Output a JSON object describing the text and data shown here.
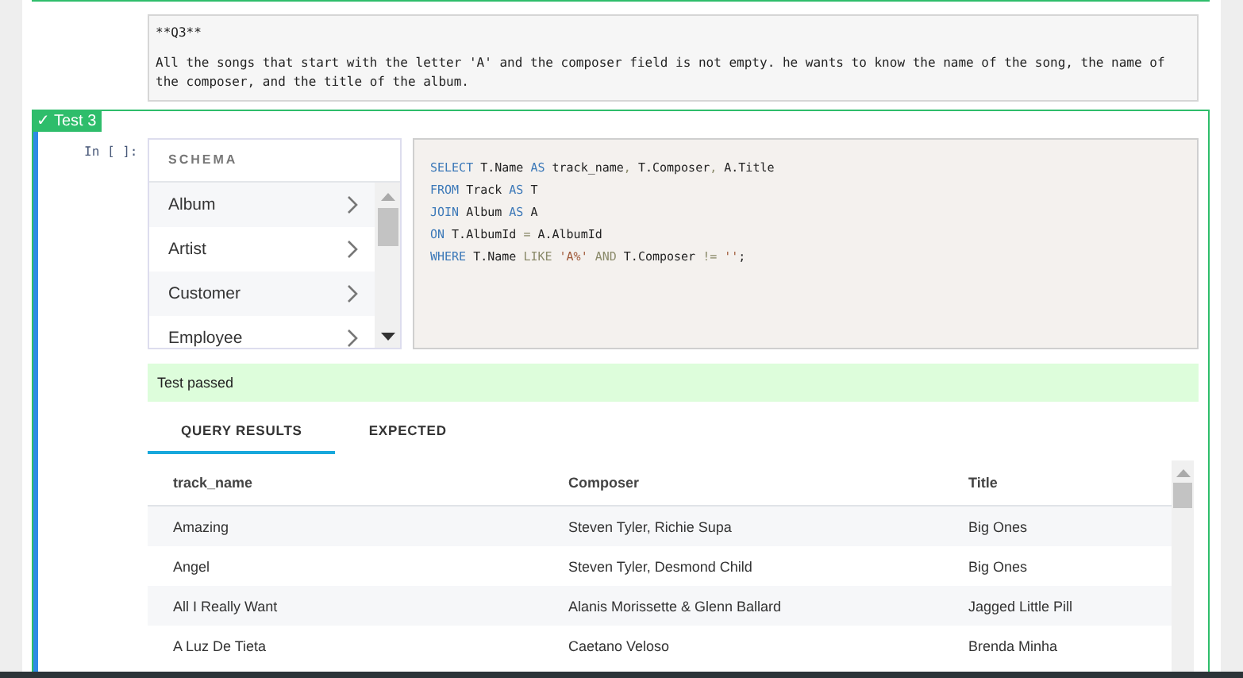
{
  "markdown_cell": {
    "heading": "**Q3**",
    "body": "All the songs that start with the letter 'A' and the composer field is not empty. he wants to know the name of the song, the name of the composer, and the title of the album."
  },
  "test_cell": {
    "badge_mark": "✓",
    "badge": "Test 3",
    "prompt": "In [ ]:",
    "schema": {
      "title": "SCHEMA",
      "items": [
        {
          "label": "Album"
        },
        {
          "label": "Artist"
        },
        {
          "label": "Customer"
        },
        {
          "label": "Employee"
        }
      ]
    },
    "code": [
      [
        {
          "kind": "kw",
          "text": "SELECT"
        },
        {
          "kind": "id",
          "text": " T.Name "
        },
        {
          "kind": "kw",
          "text": "AS"
        },
        {
          "kind": "id",
          "text": " track_name"
        },
        {
          "kind": "op",
          "text": ","
        },
        {
          "kind": "id",
          "text": " T.Composer"
        },
        {
          "kind": "op",
          "text": ","
        },
        {
          "kind": "id",
          "text": " A.Title"
        }
      ],
      [
        {
          "kind": "kw",
          "text": "FROM"
        },
        {
          "kind": "id",
          "text": " Track "
        },
        {
          "kind": "kw",
          "text": "AS"
        },
        {
          "kind": "id",
          "text": " T"
        }
      ],
      [
        {
          "kind": "kw",
          "text": "JOIN"
        },
        {
          "kind": "id",
          "text": " Album "
        },
        {
          "kind": "kw",
          "text": "AS"
        },
        {
          "kind": "id",
          "text": " A"
        }
      ],
      [
        {
          "kind": "kw",
          "text": "ON"
        },
        {
          "kind": "id",
          "text": " T.AlbumId "
        },
        {
          "kind": "op",
          "text": "="
        },
        {
          "kind": "id",
          "text": " A.AlbumId"
        }
      ],
      [
        {
          "kind": "kw",
          "text": "WHERE"
        },
        {
          "kind": "id",
          "text": " T.Name "
        },
        {
          "kind": "op",
          "text": "LIKE"
        },
        {
          "kind": "str",
          "text": " 'A%' "
        },
        {
          "kind": "op",
          "text": "AND"
        },
        {
          "kind": "id",
          "text": " T.Composer "
        },
        {
          "kind": "op",
          "text": "!="
        },
        {
          "kind": "str",
          "text": " ''"
        },
        {
          "kind": "id",
          "text": ";"
        }
      ]
    ],
    "status": "Test passed",
    "tabs": [
      {
        "label": "QUERY RESULTS",
        "selected": true
      },
      {
        "label": "EXPECTED",
        "selected": false
      }
    ],
    "table": {
      "columns": [
        "track_name",
        "Composer",
        "Title"
      ],
      "rows": [
        [
          "Amazing",
          "Steven Tyler, Richie Supa",
          "Big Ones"
        ],
        [
          "Angel",
          "Steven Tyler, Desmond Child",
          "Big Ones"
        ],
        [
          "All I Really Want",
          "Alanis Morissette & Glenn Ballard",
          "Jagged Little Pill"
        ],
        [
          "A Luz De Tieta",
          "Caetano Veloso",
          "Brenda Minha"
        ]
      ]
    }
  }
}
